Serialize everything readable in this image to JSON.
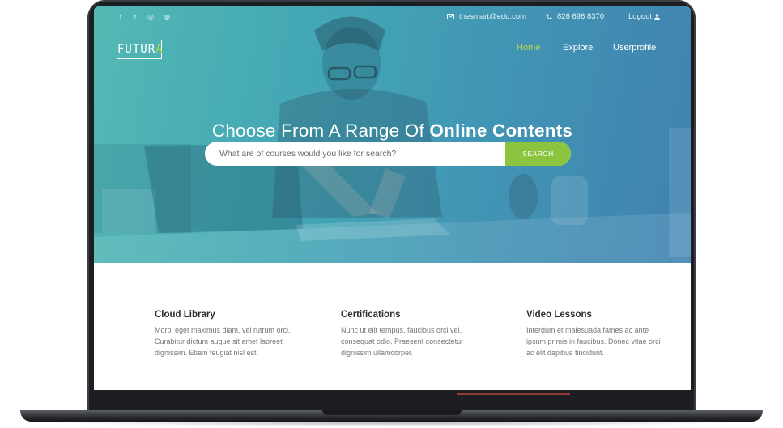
{
  "topbar": {
    "social": [
      {
        "icon": "facebook-icon",
        "glyph": "f"
      },
      {
        "icon": "twitter-icon",
        "glyph": "t"
      },
      {
        "icon": "instagram-icon",
        "glyph": "◎"
      },
      {
        "icon": "dribbble-icon",
        "glyph": "◍"
      }
    ],
    "email": "thesmart@edu.com",
    "phone": "826 696 8370",
    "logout": "Logout"
  },
  "brand": {
    "logo_main": "FUTUR",
    "logo_accent": "A"
  },
  "nav": {
    "home": "Home",
    "explore": "Explore",
    "userprofile": "Userprofile"
  },
  "hero": {
    "headline_light": "Choose From A Range Of",
    "headline_bold": "Online Contents",
    "search_placeholder": "What are of courses would you like for search?",
    "search_button": "SEARCH"
  },
  "features": [
    {
      "title": "Cloud Library",
      "text": "Morbi eget maximus diam, vel rutrum orci. Curabitur dictum augue sit amet laoreet dignissim. Etiam feugiat nisl est."
    },
    {
      "title": "Certifications",
      "text": "Nunc ut elit tempus, faucibus orci vel, consequat odio. Praesent consectetur dignissim ullamcorper."
    },
    {
      "title": "Video Lessons",
      "text": "Interdum et malesuada fames ac ante ipsum primis in faucibus. Donec vitae orci ac elit dapibus tincidunt."
    }
  ],
  "colors": {
    "accent_green": "#8cc43f",
    "nav_active": "#b5d65a",
    "hero_teal": "#4fb6b2",
    "hero_blue": "#3a7fae"
  }
}
